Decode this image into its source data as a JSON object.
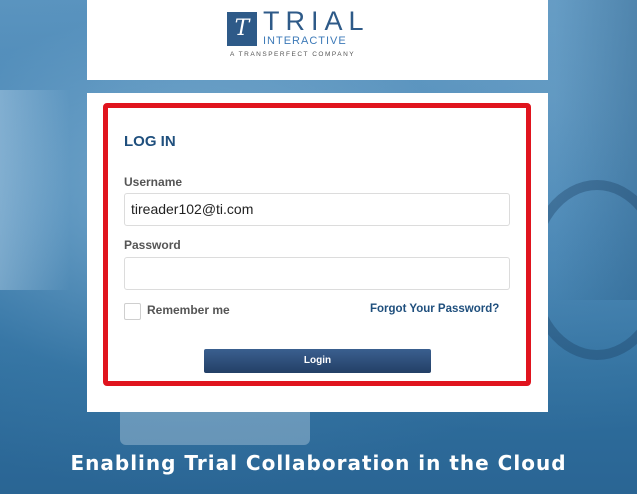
{
  "logo": {
    "mark": "T",
    "word": "TRIAL",
    "sub": "INTERACTIVE",
    "tagline": "A TRANSPERFECT COMPANY"
  },
  "login": {
    "heading": "LOG IN",
    "username_label": "Username",
    "username_value": "tireader102@ti.com",
    "password_label": "Password",
    "password_value": "",
    "remember_label": "Remember me",
    "forgot_label": "Forgot Your Password?",
    "login_button": "Login"
  },
  "footer": {
    "tagline": "Enabling Trial Collaboration in the Cloud"
  },
  "colors": {
    "brand_blue": "#2e5a88",
    "highlight_red": "#e0141e",
    "button_blue": "#233f66"
  }
}
